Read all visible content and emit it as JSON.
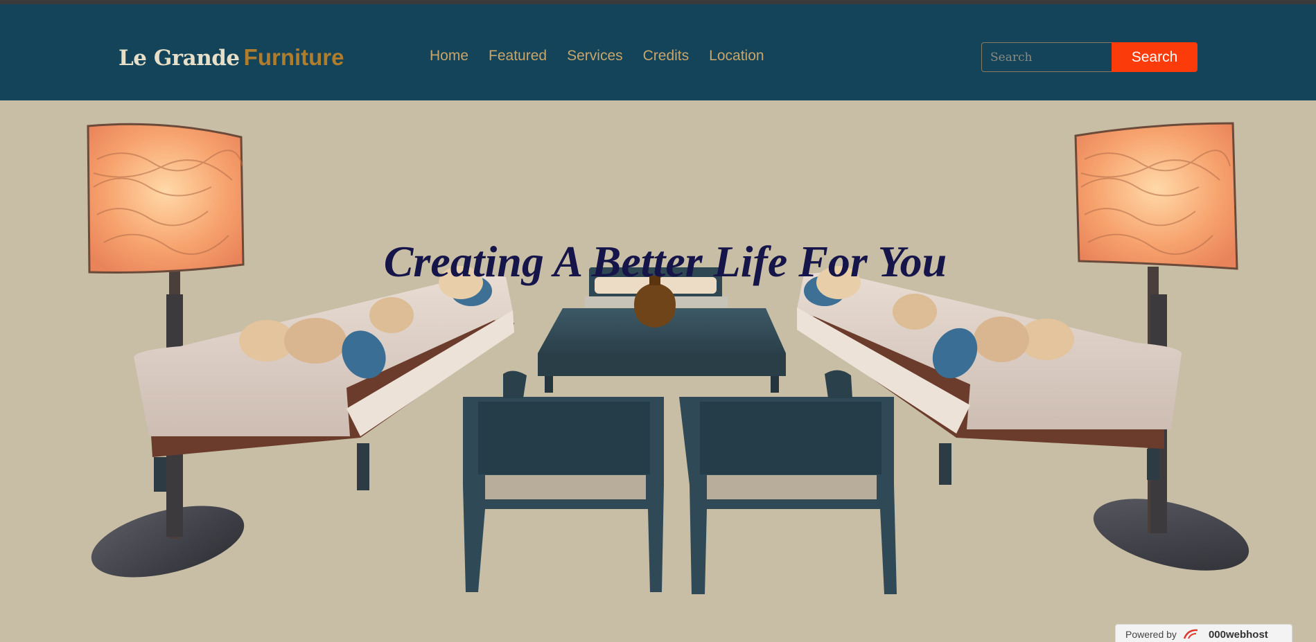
{
  "brand": {
    "part1": "Le Grande",
    "part2": "Furniture"
  },
  "nav": [
    {
      "label": "Home"
    },
    {
      "label": "Featured"
    },
    {
      "label": "Services"
    },
    {
      "label": "Credits"
    },
    {
      "label": "Location"
    }
  ],
  "search": {
    "placeholder": "Search",
    "button": "Search"
  },
  "hero": {
    "headline": "Creating A Better Life For You"
  },
  "footer_badge": {
    "powered": "Powered by",
    "host": "000webhost"
  },
  "colors": {
    "navbar": "#134459",
    "accent": "#b07d2c",
    "search_button": "#fb3b0a",
    "background": "#c8bea5",
    "headline": "#16154a"
  }
}
